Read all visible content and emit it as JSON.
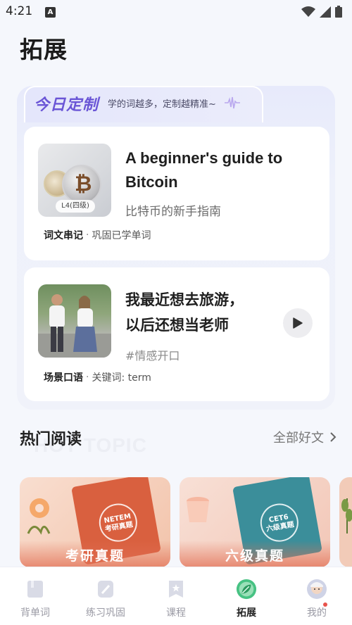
{
  "status_bar": {
    "time": "4:21",
    "notification_icon": "A"
  },
  "page": {
    "title": "拓展"
  },
  "custom": {
    "title": "今日定制",
    "subtitle": "学的词越多，定制越精准~"
  },
  "card1": {
    "level_badge": "L4(四级)",
    "title": "A beginner's guide to Bitcoin",
    "subtitle": "比特币的新手指南",
    "tag": "词文串记",
    "tag_desc": "巩固已学单词"
  },
  "card2": {
    "title_line1": "我最近想去旅游，",
    "title_line2": "以后还想当老师",
    "hashtag": "#情感开口",
    "tag": "场景口语",
    "tag_desc": "关键词: term"
  },
  "hot": {
    "bg_text": "HOT TOPIC",
    "title": "热门阅读",
    "more_label": "全部好文",
    "books": [
      {
        "cover_text_1": "NETEM",
        "cover_text_2": "考研真题",
        "label": "考研真题"
      },
      {
        "cover_text_1": "CET6",
        "cover_text_2": "六级真题",
        "label": "六级真题"
      }
    ]
  },
  "nav": {
    "items": [
      {
        "label": "背单词",
        "icon": "book-icon"
      },
      {
        "label": "练习巩固",
        "icon": "pencil-icon"
      },
      {
        "label": "课程",
        "icon": "bookmark-star-icon"
      },
      {
        "label": "拓展",
        "icon": "leaf-icon"
      },
      {
        "label": "我的",
        "icon": "avatar-icon"
      }
    ],
    "active_color": "#3db97a"
  }
}
